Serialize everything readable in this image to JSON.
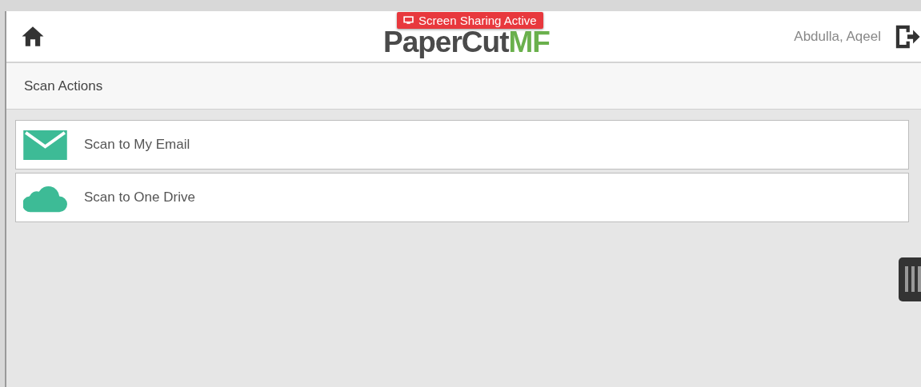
{
  "header": {
    "logo_main": "PaperCut",
    "logo_accent": "MF",
    "user": "Abdulla, Aqeel"
  },
  "banner": {
    "label": "Screen Sharing Active"
  },
  "section": {
    "title": "Scan Actions"
  },
  "actions": [
    {
      "kind": "email",
      "label": "Scan to My Email"
    },
    {
      "kind": "cloud",
      "label": "Scan to One Drive"
    }
  ]
}
